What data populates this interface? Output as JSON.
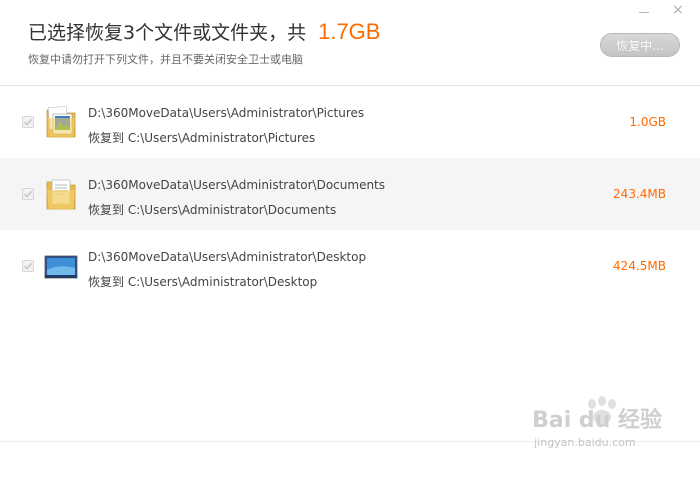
{
  "window_controls": {
    "minimize_icon": "minimize-icon",
    "close_icon": "close-icon",
    "close_glyph": "×"
  },
  "header": {
    "title": "已选择恢复3个文件或文件夹，共",
    "total_size": "1.7GB",
    "subtitle": "恢复中请勿打开下列文件，并且不要关闭安全卫士或电脑",
    "recover_button_label": "恢复中..."
  },
  "files": [
    {
      "path": "D:\\360MoveData\\Users\\Administrator\\Pictures",
      "dest": "恢复到 C:\\Users\\Administrator\\Pictures",
      "size": "1.0GB",
      "icon": "pictures-folder-icon",
      "checked": true
    },
    {
      "path": "D:\\360MoveData\\Users\\Administrator\\Documents",
      "dest": "恢复到 C:\\Users\\Administrator\\Documents",
      "size": "243.4MB",
      "icon": "documents-folder-icon",
      "checked": true
    },
    {
      "path": "D:\\360MoveData\\Users\\Administrator\\Desktop",
      "dest": "恢复到 C:\\Users\\Administrator\\Desktop",
      "size": "424.5MB",
      "icon": "desktop-icon",
      "checked": true
    }
  ],
  "watermark": {
    "main": "Bai du 经验",
    "url": "jingyan.baidu.com"
  },
  "colors": {
    "accent": "#ff6a00",
    "row_alt": "#f5f5f5",
    "button_disabled": "#c8c8c8"
  }
}
